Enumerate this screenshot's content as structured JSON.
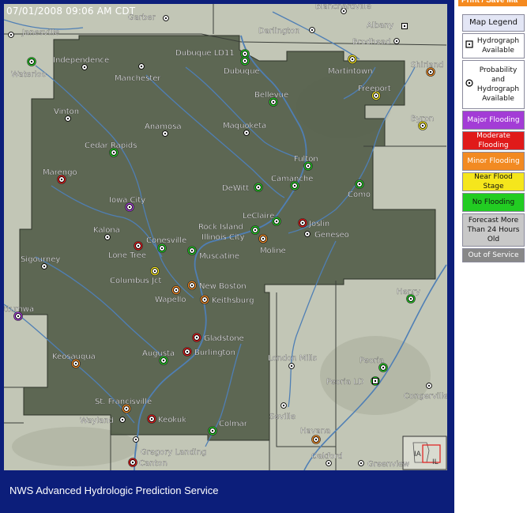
{
  "timestamp": "07/01/2008 09:06 AM CDT",
  "footer": "NWS Advanced Hydrologic Prediction Service",
  "print_button": "Print / Save Ma",
  "colors": {
    "frame": "#0c1e7a",
    "land": "#c2c6b6",
    "service_area": "#4f5a46",
    "river": "#4f7fb5",
    "major": "#a33cd6",
    "moderate": "#e01a1a",
    "minor": "#f28a22",
    "action": "#f5e61c",
    "no_flooding": "#22cc22",
    "old": "#c8c8c8",
    "out_of_service": "#888888"
  },
  "legend": {
    "title": "Map Legend",
    "items": [
      {
        "kind": "hydrograph",
        "label": "Hydrograph Available"
      },
      {
        "kind": "probability",
        "label": "Probability and Hydrograph Available"
      },
      {
        "kind": "major",
        "label": "Major Flooding",
        "color": "#a33cd6",
        "text_color": "#ffffff"
      },
      {
        "kind": "moderate",
        "label": "Moderate Flooding",
        "color": "#e01a1a",
        "text_color": "#ffffff"
      },
      {
        "kind": "minor",
        "label": "Minor Flooding",
        "color": "#f28a22",
        "text_color": "#ffffff"
      },
      {
        "kind": "action",
        "label": "Near Flood Stage",
        "color": "#f5e61c",
        "text_color": "#111111"
      },
      {
        "kind": "no_flooding",
        "label": "No Flooding",
        "color": "#22cc22",
        "text_color": "#111111"
      },
      {
        "kind": "old",
        "label": "Forecast More Than 24 Hours Old"
      },
      {
        "kind": "oos",
        "label": "Out of Service"
      }
    ]
  },
  "inset": {
    "labels": [
      "IA",
      "IL"
    ]
  },
  "gauges": [
    {
      "name": "Janesville",
      "status": "none",
      "type": "prob"
    },
    {
      "name": "Garber",
      "status": "none",
      "type": "prob"
    },
    {
      "name": "Darlington",
      "status": "none",
      "type": "prob"
    },
    {
      "name": "Albany",
      "status": "none",
      "type": "hydro"
    },
    {
      "name": "Brodhead",
      "status": "none",
      "type": "prob"
    },
    {
      "name": "Waterloo",
      "status": "no_flooding",
      "type": "prob"
    },
    {
      "name": "Independence",
      "status": "none",
      "type": "prob"
    },
    {
      "name": "Manchester",
      "status": "none",
      "type": "prob"
    },
    {
      "name": "Dubuque LD11",
      "status": "no_flooding",
      "type": "prob"
    },
    {
      "name": "Dubuque",
      "status": "no_flooding",
      "type": "prob"
    },
    {
      "name": "Martintown",
      "status": "action",
      "type": "prob"
    },
    {
      "name": "Shirland",
      "status": "minor",
      "type": "prob"
    },
    {
      "name": "Freeport",
      "status": "action",
      "type": "prob"
    },
    {
      "name": "Vinton",
      "status": "none",
      "type": "prob"
    },
    {
      "name": "Bellevue",
      "status": "no_flooding",
      "type": "prob"
    },
    {
      "name": "Anamosa",
      "status": "none",
      "type": "prob"
    },
    {
      "name": "Maquoketa",
      "status": "none",
      "type": "prob"
    },
    {
      "name": "Byron",
      "status": "action",
      "type": "prob"
    },
    {
      "name": "Cedar Rapids",
      "status": "no_flooding",
      "type": "prob"
    },
    {
      "name": "Fulton",
      "status": "no_flooding",
      "type": "prob"
    },
    {
      "name": "Marengo",
      "status": "moderate",
      "type": "prob"
    },
    {
      "name": "Camanche",
      "status": "no_flooding",
      "type": "prob"
    },
    {
      "name": "DeWitt",
      "status": "no_flooding",
      "type": "prob"
    },
    {
      "name": "Como",
      "status": "no_flooding",
      "type": "prob"
    },
    {
      "name": "Iowa City",
      "status": "major",
      "type": "prob"
    },
    {
      "name": "LeClaire",
      "status": "no_flooding",
      "type": "prob"
    },
    {
      "name": "Joslin",
      "status": "moderate",
      "type": "prob"
    },
    {
      "name": "Rock Island",
      "status": "no_flooding",
      "type": "prob"
    },
    {
      "name": "Geneseo",
      "status": "none",
      "type": "prob"
    },
    {
      "name": "Kalona",
      "status": "none",
      "type": "prob"
    },
    {
      "name": "Conesville",
      "status": "no_flooding",
      "type": "prob"
    },
    {
      "name": "Illinois City",
      "status": "no_flooding",
      "type": "prob"
    },
    {
      "name": "Moline",
      "status": "minor",
      "type": "prob"
    },
    {
      "name": "Lone Tree",
      "status": "moderate",
      "type": "prob"
    },
    {
      "name": "Muscatine",
      "status": "no_flooding",
      "type": "prob"
    },
    {
      "name": "Sigourney",
      "status": "none",
      "type": "prob"
    },
    {
      "name": "Columbus Jct",
      "status": "action",
      "type": "prob"
    },
    {
      "name": "New Boston",
      "status": "minor",
      "type": "prob"
    },
    {
      "name": "Wapello",
      "status": "minor",
      "type": "prob"
    },
    {
      "name": "Keithsburg",
      "status": "minor",
      "type": "prob"
    },
    {
      "name": "Henry",
      "status": "no_flooding",
      "type": "prob"
    },
    {
      "name": "Ottumwa",
      "status": "major",
      "type": "prob"
    },
    {
      "name": "Gladstone",
      "status": "moderate",
      "type": "prob"
    },
    {
      "name": "Augusta",
      "status": "no_flooding",
      "type": "prob"
    },
    {
      "name": "Burlington",
      "status": "moderate",
      "type": "prob"
    },
    {
      "name": "London Mills",
      "status": "none",
      "type": "prob"
    },
    {
      "name": "Peoria",
      "status": "no_flooding",
      "type": "prob"
    },
    {
      "name": "Keosauqua",
      "status": "minor",
      "type": "prob"
    },
    {
      "name": "Peoria LD",
      "status": "no_flooding",
      "type": "hydro"
    },
    {
      "name": "Congerville",
      "status": "none",
      "type": "prob"
    },
    {
      "name": "St. Francisville",
      "status": "minor",
      "type": "prob"
    },
    {
      "name": "Seville",
      "status": "none",
      "type": "prob"
    },
    {
      "name": "Wayland",
      "status": "none",
      "type": "prob"
    },
    {
      "name": "Keokuk",
      "status": "moderate",
      "type": "prob"
    },
    {
      "name": "Colmar",
      "status": "no_flooding",
      "type": "prob"
    },
    {
      "name": "Havana",
      "status": "minor",
      "type": "prob"
    },
    {
      "name": "Gregory Landing",
      "status": "none",
      "type": "prob"
    },
    {
      "name": "Oakford",
      "status": "none",
      "type": "prob"
    },
    {
      "name": "Canton",
      "status": "moderate",
      "type": "prob"
    },
    {
      "name": "Greenview",
      "status": "none",
      "type": "prob"
    },
    {
      "name": "Blanchardville",
      "status": "none",
      "type": "prob"
    }
  ]
}
